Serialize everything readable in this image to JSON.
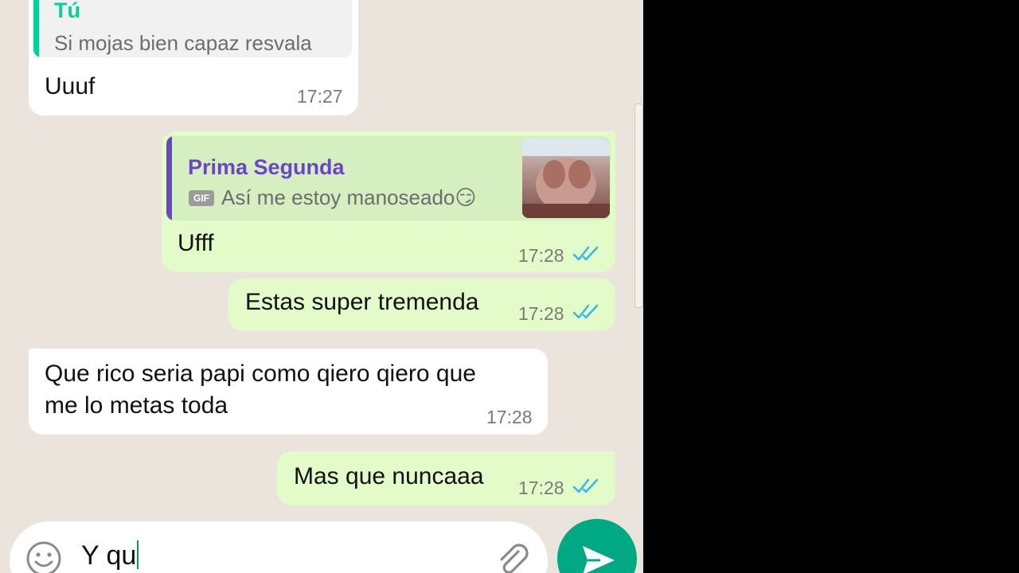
{
  "conversation": {
    "messages": [
      {
        "direction": "incoming",
        "quote": {
          "author": "Tú",
          "text": "Si mojas bien capaz resvala"
        },
        "text": "Uuuf",
        "time": "17:27"
      },
      {
        "direction": "outgoing",
        "quote": {
          "author": "Prima Segunda",
          "badge": "GIF",
          "text": "Así me estoy manoseado😏",
          "has_thumbnail": true
        },
        "text": "Ufff",
        "time": "17:28",
        "status": "read"
      },
      {
        "direction": "outgoing",
        "text": "Estas super tremenda",
        "time": "17:28",
        "status": "read"
      },
      {
        "direction": "incoming",
        "text": "Que rico seria papi como qiero qiero que\nme lo metas toda",
        "time": "17:28"
      },
      {
        "direction": "outgoing",
        "text": "Mas que nuncaaa",
        "time": "17:28",
        "status": "read"
      }
    ]
  },
  "composer": {
    "text": "Y qu",
    "emoji_icon": "emoji-icon",
    "attach_icon": "paperclip-icon",
    "send_icon": "send-icon"
  },
  "colors": {
    "chat_background": "#ebe4dc",
    "incoming_bubble": "#ffffff",
    "outgoing_bubble": "#e2fbc8",
    "read_ticks": "#34b7f1",
    "accent": "#00a884",
    "quote_self": "#06cf9c",
    "quote_other": "#6a45c8"
  }
}
